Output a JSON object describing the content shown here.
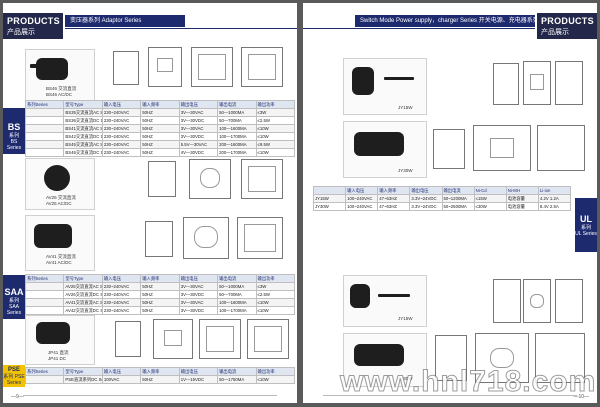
{
  "left_page": {
    "header": {
      "title_en": "PRODUCTS",
      "title_cn": "产品展示",
      "section": "变压器系列 Adaptor Series"
    },
    "bs": {
      "tab_line1": "BS",
      "tab_line2": "系列",
      "tab_line3": "BS Series",
      "product_label_1": "BS46 交流直流",
      "product_label_2": "BS46 AC/DC",
      "table": {
        "header": [
          "系列Series",
          "型号Type",
          "输入电压",
          "输入频率",
          "输出电压",
          "输出电流",
          "输出功率"
        ],
        "rows": [
          [
            "",
            "BS35交流直流AC Series",
            "230~240VAC",
            "50HZ",
            "3V—30VAC",
            "50—1000MA",
            "≤3W"
          ],
          [
            "",
            "BS36交流直流DC Series",
            "230~240VAC",
            "50HZ",
            "3V—30VDC",
            "50—700MA",
            "≤2.5W"
          ],
          [
            "",
            "BS41交流直流AC Series",
            "230~240VAC",
            "50HZ",
            "3V—30VAC",
            "100—1600MA",
            "≤10W"
          ],
          [
            "",
            "BS42交流直流DC Series",
            "230~240VAC",
            "50HZ",
            "3V—30VDC",
            "100—1700MA",
            "≤10W"
          ],
          [
            "",
            "BS45交流直流AC Series",
            "230~240VAC",
            "50HZ",
            "5.5V—30VAC",
            "200—1600MA",
            "≤9.5W"
          ],
          [
            "",
            "BS46交流直流DC Series",
            "230~240VAC",
            "50HZ",
            "4V—30VDC",
            "200—1700MA",
            "≤10W"
          ]
        ]
      }
    },
    "saa": {
      "tab_line1": "SAA",
      "tab_line2": "系列",
      "tab_line3": "SAA Series",
      "product_label_1a": "AV25 交流直流",
      "product_label_1b": "AV25 AC/DC",
      "product_label_2a": "AV41 交流直流",
      "product_label_2b": "AV41 AC/DC",
      "table": {
        "header": [
          "系列Series",
          "型号Type",
          "输入电压",
          "输入频率",
          "输出电压",
          "输出电流",
          "输出功率"
        ],
        "rows": [
          [
            "",
            "AV25交流直流AC Series",
            "230~240VAC",
            "50HZ",
            "3V—30VAC",
            "50—1000MA",
            "≤3W"
          ],
          [
            "",
            "AV26交流直流DC Series",
            "230~240VAC",
            "50HZ",
            "3V—30VDC",
            "50—700MA",
            "≤2.5W"
          ],
          [
            "",
            "AV41交流直流AC Series",
            "230~240VAC",
            "50HZ",
            "3V—30VAC",
            "100—1600MA",
            "≤10W"
          ],
          [
            "",
            "AV42交流直流DC Series",
            "230~240VAC",
            "50HZ",
            "3V—30VDC",
            "100—1700MA",
            "≤10W"
          ]
        ]
      }
    },
    "pse": {
      "tab_line1": "PSE",
      "tab_line2": "系列",
      "tab_line3": "PSE Series",
      "product_label_1": "JP41 直流",
      "product_label_2": "JP41 DC",
      "table": {
        "header": [
          "系列Series",
          "型号Type",
          "输入电压",
          "输入频率",
          "输出电压",
          "输出电流",
          "输出功率"
        ],
        "rows": [
          [
            "",
            "PSE直流系列DC Series",
            "100VAC",
            "50HZ",
            "1V—15VDC",
            "50—1750MA",
            "≤10W"
          ]
        ]
      }
    },
    "page_number": "—9—"
  },
  "right_page": {
    "header": {
      "title_en": "PRODUCTS",
      "title_cn": "产品展示",
      "section": "Switch Mode Power supply，charger Series 开关电源、充电器系列"
    },
    "ul": {
      "tab_line1": "UL",
      "tab_line2": "系列",
      "tab_line3": "UL Series",
      "product_label_1": "JY15W",
      "product_label_2": "JY30W",
      "table": {
        "header": [
          "",
          "输入电压",
          "输入频率",
          "输出电压",
          "输出电流",
          "Ni-Cd",
          "Ni-MH",
          "Li-ion"
        ],
        "rows": [
          [
            "JY15W",
            "100~240VAC",
            "47~63HZ",
            "3.3V~24VDC",
            "50~1200MA",
            "≤15W",
            "电池容量",
            "4.2V 1.2A"
          ],
          [
            "JY30W",
            "100~240VAC",
            "47~63HZ",
            "3.3V~24VDC",
            "50~2500MA",
            "≤30W",
            "电池容量",
            "8.4V 2.5A"
          ]
        ]
      }
    },
    "eu": {
      "product_label_1": "JY15W",
      "product_label_2": "JY30W"
    },
    "page_number": "—10—"
  },
  "watermark": "www.hnl718.com"
}
